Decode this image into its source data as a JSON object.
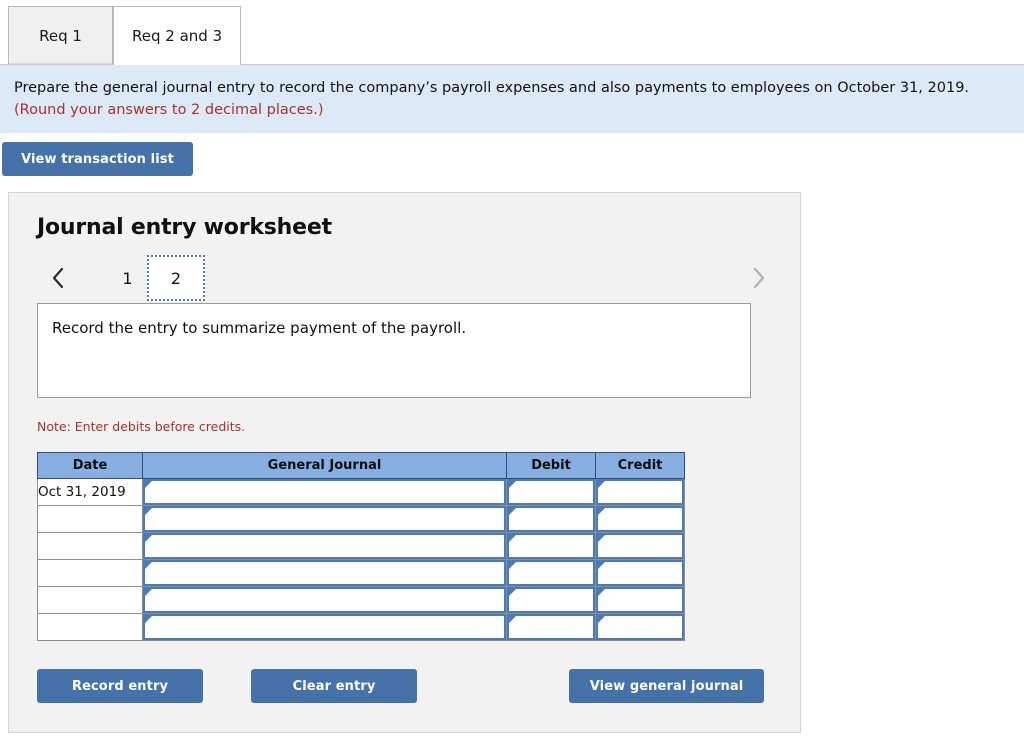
{
  "tabs": [
    {
      "label": "Req 1",
      "active": false
    },
    {
      "label": "Req 2 and 3",
      "active": true
    }
  ],
  "banner": {
    "text": "Prepare the general journal entry to record the company’s payroll expenses and also payments to employees on October 31, 2019.",
    "hint": "(Round your answers to 2 decimal places.)"
  },
  "toolbar": {
    "view_transaction_list_label": "View transaction list"
  },
  "worksheet": {
    "title": "Journal entry worksheet",
    "pager": {
      "prev_icon": "chevron-left-icon",
      "next_icon": "chevron-right-icon",
      "pages": [
        "1",
        "2"
      ],
      "selected_page": "2"
    },
    "description": "Record the entry to summarize payment of the payroll.",
    "note": "Note: Enter debits before credits.",
    "table": {
      "headers": [
        "Date",
        "General Journal",
        "Debit",
        "Credit"
      ],
      "rows": [
        {
          "date": "Oct 31, 2019",
          "general_journal": "",
          "debit": "",
          "credit": ""
        },
        {
          "date": "",
          "general_journal": "",
          "debit": "",
          "credit": ""
        },
        {
          "date": "",
          "general_journal": "",
          "debit": "",
          "credit": ""
        },
        {
          "date": "",
          "general_journal": "",
          "debit": "",
          "credit": ""
        },
        {
          "date": "",
          "general_journal": "",
          "debit": "",
          "credit": ""
        },
        {
          "date": "",
          "general_journal": "",
          "debit": "",
          "credit": ""
        }
      ]
    },
    "actions": {
      "record_label": "Record entry",
      "clear_label": "Clear entry",
      "view_general_journal_label": "View general journal"
    }
  },
  "colors": {
    "button_blue": "#4472a9",
    "header_blue": "#86aee0",
    "banner_blue": "#dceaf8",
    "note_red": "#a8312b",
    "cell_border_blue": "#4a7bb5",
    "panel_gray": "#f2f2f2"
  }
}
